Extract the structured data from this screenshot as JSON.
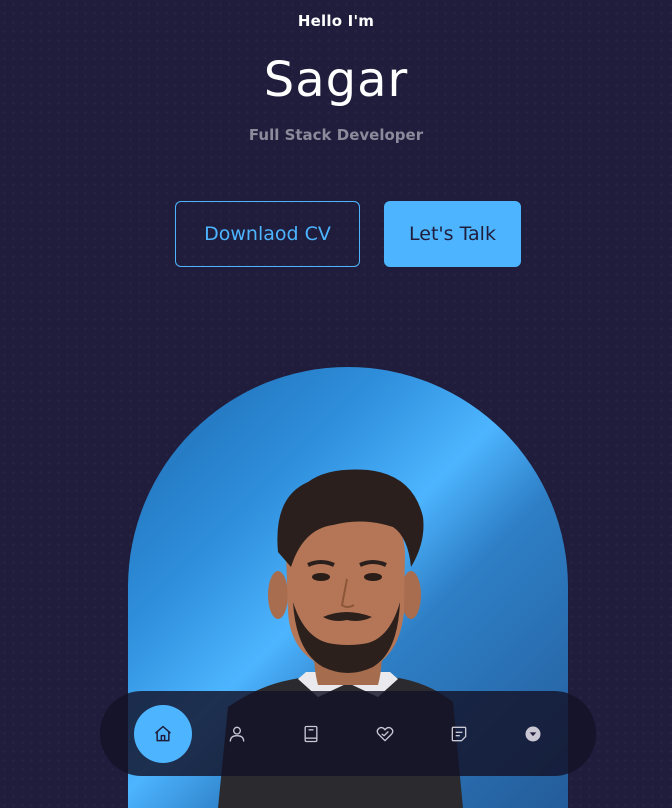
{
  "hero": {
    "greeting": "Hello I'm",
    "name": "Sagar",
    "role": "Full Stack Developer"
  },
  "buttons": {
    "download_cv": "Downlaod CV",
    "lets_talk": "Let's Talk"
  },
  "colors": {
    "background": "#1f1d3b",
    "accent": "#4db5ff",
    "muted_text": "#8d8a9c",
    "nav_background": "#141228"
  },
  "portrait": {
    "alt": "portrait-photo"
  },
  "nav": {
    "items": [
      {
        "icon": "home-icon",
        "active": true
      },
      {
        "icon": "user-icon",
        "active": false
      },
      {
        "icon": "book-icon",
        "active": false
      },
      {
        "icon": "services-icon",
        "active": false
      },
      {
        "icon": "message-icon",
        "active": false
      },
      {
        "icon": "chevron-down-circle-icon",
        "active": false
      }
    ]
  }
}
